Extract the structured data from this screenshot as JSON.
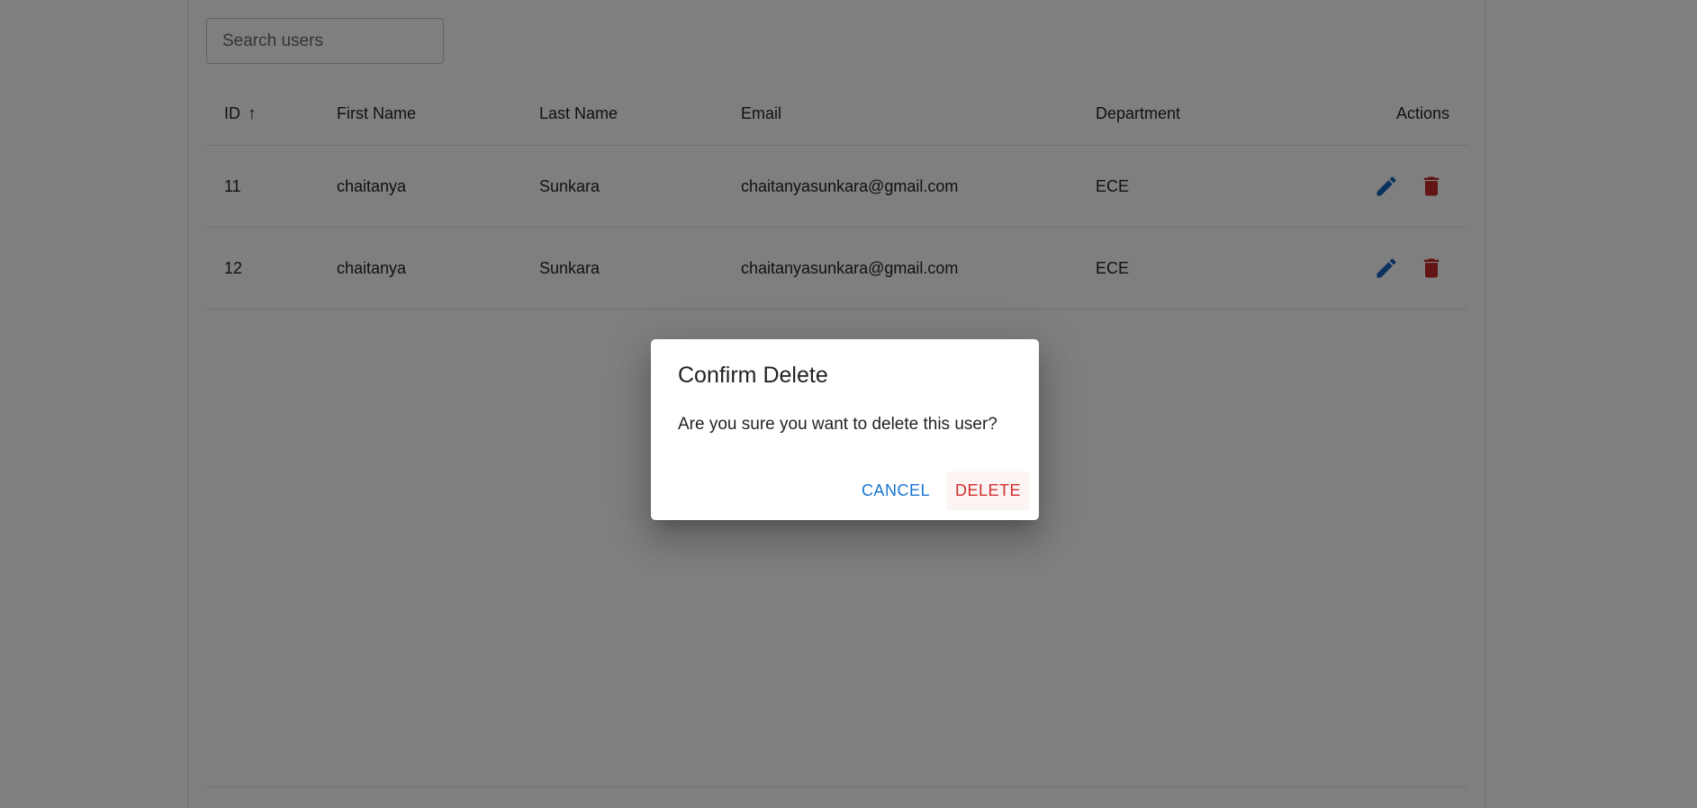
{
  "search": {
    "placeholder": "Search users",
    "value": ""
  },
  "table": {
    "headers": {
      "id": "ID",
      "first_name": "First Name",
      "last_name": "Last Name",
      "email": "Email",
      "department": "Department",
      "actions": "Actions"
    },
    "sort": {
      "column": "ID",
      "direction": "ascending",
      "icon": "arrow-up-icon"
    },
    "rows": [
      {
        "id": "11",
        "first_name": "chaitanya",
        "last_name": "Sunkara",
        "email": "chaitanyasunkara@gmail.com",
        "department": "ECE"
      },
      {
        "id": "12",
        "first_name": "chaitanya",
        "last_name": "Sunkara",
        "email": "chaitanyasunkara@gmail.com",
        "department": "ECE"
      }
    ],
    "row_actions": [
      {
        "name": "edit",
        "icon": "pencil-icon",
        "color": "#1565c0"
      },
      {
        "name": "delete",
        "icon": "trash-icon",
        "color": "#c62828"
      }
    ]
  },
  "dialog": {
    "title": "Confirm Delete",
    "message": "Are you sure you want to delete this user?",
    "cancel_label": "CANCEL",
    "delete_label": "DELETE",
    "cancel_color": "#1976d2",
    "delete_color": "#d32f2f"
  }
}
